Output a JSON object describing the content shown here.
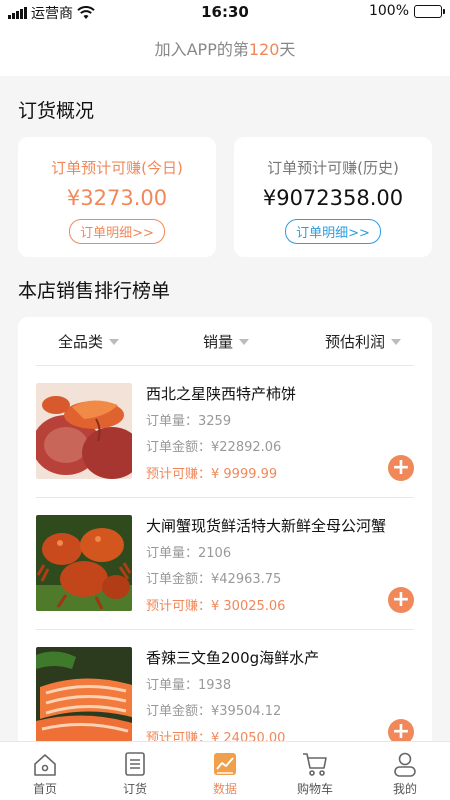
{
  "status_bar": {
    "carrier": "运营商",
    "time": "16:30",
    "battery": "100%"
  },
  "join_banner": {
    "prefix": "加入APP的第",
    "days": "120",
    "suffix": "天"
  },
  "order_overview": {
    "title": "订货概况",
    "today": {
      "label": "订单预计可赚(今日)",
      "amount": "¥3273.00",
      "detail_button": "订单明细>>"
    },
    "history": {
      "label": "订单预计可赚(历史)",
      "amount": "¥9072358.00",
      "detail_button": "订单明细>>"
    }
  },
  "ranking": {
    "title": "本店销售排行榜单",
    "sort_options": [
      {
        "label": "全品类"
      },
      {
        "label": "销量"
      },
      {
        "label": "预估利润"
      }
    ],
    "products": [
      {
        "name": "西北之星陕西特产柿饼",
        "order_qty": "订单量：3259",
        "order_amount": "订单金额：¥22892.06",
        "earn": "预计可赚：¥ 9999.99"
      },
      {
        "name": "大闸蟹现货鲜活特大新鲜全母公河蟹",
        "order_qty": "订单量：2106",
        "order_amount": "订单金额：¥42963.75",
        "earn": "预计可赚：¥ 30025.06"
      },
      {
        "name": "香辣三文鱼200g海鲜水产",
        "order_qty": "订单量：1938",
        "order_amount": "订单金额：¥39504.12",
        "earn": "预计可赚：¥ 24050.00"
      }
    ]
  },
  "tabbar": {
    "items": [
      {
        "label": "首页",
        "icon": "home-icon"
      },
      {
        "label": "订货",
        "icon": "order-icon"
      },
      {
        "label": "数据",
        "icon": "data-chart-icon"
      },
      {
        "label": "购物车",
        "icon": "cart-icon"
      },
      {
        "label": "我的",
        "icon": "profile-icon"
      }
    ],
    "active_index": 2
  },
  "colors": {
    "accent": "#f0885a",
    "link": "#2b9de0"
  }
}
